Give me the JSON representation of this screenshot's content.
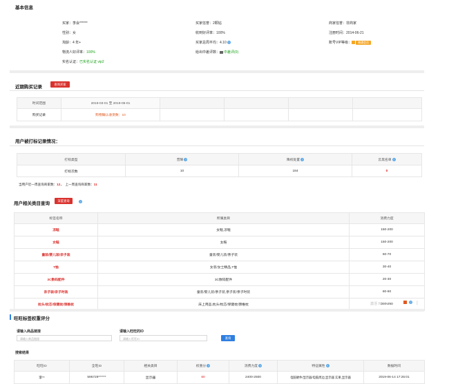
{
  "basic_info": {
    "title": "基本信息",
    "fields": [
      {
        "label": "买家：",
        "value": "李会******"
      },
      {
        "label": "性别：",
        "value": "女"
      },
      {
        "label": "淘龄：",
        "value": "4 年+"
      },
      {
        "label": "物流人好评率：",
        "value": "100%"
      },
      {
        "label": "实名认证：",
        "value": "已实名认证",
        "extra": "vip2"
      },
      {
        "label": "买家信誉：",
        "value": "2颗钻"
      },
      {
        "label": "收到好评率：",
        "value": "100%"
      },
      {
        "label": "买家总周平均：",
        "value": "4.10"
      },
      {
        "label": "给出中差评数：",
        "value": "中差评(0)"
      },
      {
        "label": "商家信誉：",
        "value": "非商家"
      },
      {
        "label": "注册时间：",
        "value": "2014-06-21"
      },
      {
        "label": "账号VIP等级：",
        "value": "",
        "badge": "普通会员"
      }
    ]
  },
  "recent_purchase": {
    "title": "近期购买记录",
    "button": "查询买家",
    "header": [
      "时间范围",
      "2019-03-01 至 2019-05-01",
      "",
      "",
      "",
      ""
    ],
    "row": [
      "购买记录",
      "购物确认收货数：10",
      "",
      "",
      "",
      ""
    ]
  },
  "tagged": {
    "title": "用户被打标记录情况：",
    "header": [
      "打标类型",
      "普降",
      "降权处置",
      "云黑名单"
    ],
    "row": [
      "打标次数",
      "10",
      "184",
      "0"
    ],
    "week_line_label": "当用户近一周查询商家数：",
    "week_value": "12",
    "sep": "，",
    "last_week_label": "上一周查询商家数：",
    "last_week_value": "11"
  },
  "category_query": {
    "title": "用户相关类目查询",
    "button": "深度查询",
    "header": [
      "标签名称",
      "所属类目",
      "消费力度"
    ],
    "rows": [
      {
        "tag": "凉鞋",
        "category": "女鞋,凉鞋",
        "level": "150-200"
      },
      {
        "tag": "女鞋",
        "category": "女鞋",
        "level": "150-200"
      },
      {
        "tag": "童装/婴儿装/亲子装",
        "category": "童装/婴儿装/亲子装",
        "level": "60-70"
      },
      {
        "tag": "T恤",
        "category": "女装/女士精品,T恤",
        "level": "30-40"
      },
      {
        "tag": "3C数码配件",
        "category": "3C数码配件",
        "level": "20-30"
      },
      {
        "tag": "亲子装/亲子时装",
        "category": "童装/婴儿装/亲子装,亲子装/亲子时装",
        "level": "80-90"
      },
      {
        "tag": "枕头/枕芯/保健枕/颈椎枕",
        "category": "床上用品,枕头/枕芯/保健枕/颈椎枕",
        "level": "200-250"
      }
    ],
    "watermark": "激活 Windows"
  },
  "weight_eval": {
    "title": "旺旺标签权重评分",
    "label1": "请输入商品链接",
    "placeholder1": "请输入商品链接",
    "label2": "请输入旺旺的ID",
    "placeholder2": "请输入旺旺ID",
    "search_button": "查询",
    "results_title": "搜索结果",
    "header": [
      "旺旺ID",
      "全旺ID",
      "相关类目",
      "权重分",
      "消费力度",
      "特征属性",
      "数据时间"
    ],
    "row": [
      "李**",
      "595729******",
      "显示器",
      "60",
      "2400-2500",
      "电脑硬件/显示器/电脑周边,显示器 实果,显示器",
      "2019-06-14 17:25:01"
    ]
  },
  "colors": {
    "accent_red": "#d9322e",
    "accent_blue": "#2f7fe0",
    "success_green": "#1aa01a"
  }
}
